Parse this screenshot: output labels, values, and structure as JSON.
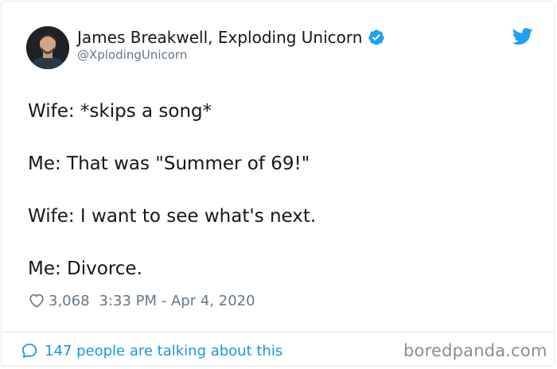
{
  "author": {
    "display_name": "James Breakwell, Exploding Unicorn",
    "handle": "@XplodingUnicorn",
    "verified": true
  },
  "tweet": {
    "lines": [
      "Wife: *skips a song*",
      "Me: That was \"Summer of 69!\"",
      "Wife: I want to see what's next.",
      "Me: Divorce."
    ]
  },
  "meta": {
    "likes": "3,068",
    "timestamp": "3:33 PM - Apr 4, 2020"
  },
  "footer": {
    "conversation_link": "147 people are talking about this"
  },
  "watermark": "boredpanda.com",
  "icons": {
    "verified": "verified-badge-icon",
    "brand": "twitter-bird-icon",
    "like": "heart-icon",
    "reply": "comment-icon"
  },
  "colors": {
    "twitter_blue": "#1da1f2",
    "link_blue": "#1b95e0",
    "secondary_text": "#657786",
    "primary_text": "#14171a"
  }
}
